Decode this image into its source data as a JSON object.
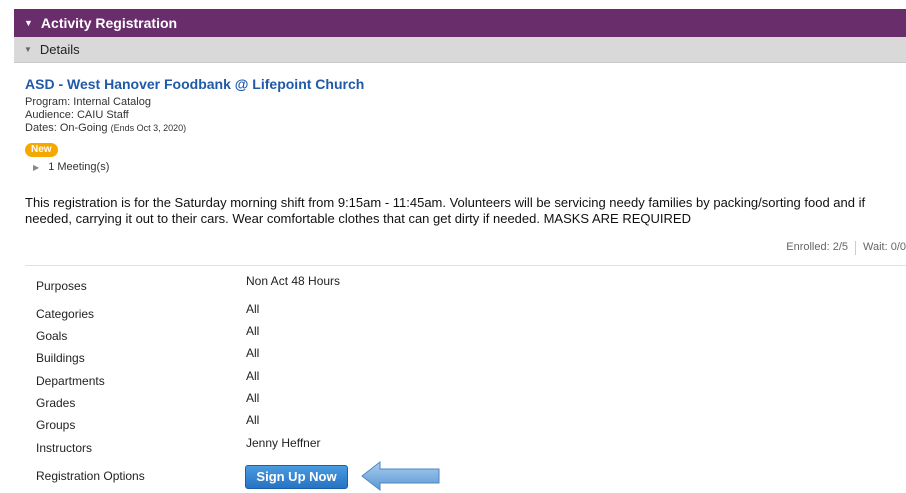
{
  "header": {
    "title": "Activity Registration"
  },
  "details_bar": {
    "label": "Details"
  },
  "activity": {
    "title": "ASD - West Hanover Foodbank @ Lifepoint Church",
    "program": "Program: Internal Catalog",
    "audience": "Audience: CAIU Staff",
    "dates": "Dates: On-Going",
    "dates_note": "(Ends Oct 3, 2020)",
    "badge": "New",
    "meetings": "1 Meeting(s)",
    "description": "This registration is for the Saturday morning shift from 9:15am - 11:45am. Volunteers will be servicing needy families by packing/sorting food and if needed, carrying it out to their cars. Wear comfortable clothes that can get dirty if needed. MASKS ARE REQUIRED",
    "enrolled": "Enrolled: 2/5",
    "wait": "Wait: 0/0"
  },
  "attributes": [
    {
      "label": "Purposes",
      "value": "Non Act 48 Hours"
    },
    {
      "label": "Categories",
      "value": "All"
    },
    {
      "label": "Goals",
      "value": "All"
    },
    {
      "label": "Buildings",
      "value": "All"
    },
    {
      "label": "Departments",
      "value": "All"
    },
    {
      "label": "Grades",
      "value": "All"
    },
    {
      "label": "Groups",
      "value": "All"
    },
    {
      "label": "Instructors",
      "value": "Jenny Heffner"
    },
    {
      "label": "Registration Options",
      "value": ""
    }
  ],
  "signup": {
    "label": "Sign Up Now"
  },
  "colors": {
    "header_bg": "#6a2d6c",
    "title_link": "#1f5aa8",
    "badge": "#f5a800",
    "button": "#2673c4",
    "arrow": "#6fa8dc"
  },
  "icons": {
    "collapse": "triangle-down-icon",
    "expand": "triangle-right-icon",
    "pointer": "left-arrow-icon"
  }
}
